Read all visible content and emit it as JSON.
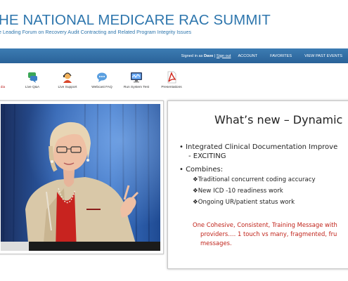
{
  "header": {
    "title": "HE NATIONAL MEDICARE RAC SUMMIT",
    "subtitle": "e Leading Forum on Recovery Audit Contracting and Related Program Integrity Issues"
  },
  "nav": {
    "signed_prefix": "Signed in as",
    "user": "Dave",
    "separator": "|",
    "signout": "Sign out",
    "links": [
      "ACCOUNT",
      "FAVORITES",
      "VIEW PAST EVENTS"
    ]
  },
  "toolbar": {
    "items": [
      {
        "label": "dia",
        "icon": "media-icon"
      },
      {
        "label": "Live Q&A",
        "icon": "chat-bubbles-icon"
      },
      {
        "label": "Live Support",
        "icon": "support-agent-icon"
      },
      {
        "label": "Webcast FAQ",
        "icon": "faq-bubble-icon"
      },
      {
        "label": "Run System Test",
        "icon": "system-test-monitor-icon"
      },
      {
        "label": "Presentations",
        "icon": "pdf-icon"
      }
    ]
  },
  "slide": {
    "title": "What’s new – Dynamic",
    "bullets": [
      {
        "line1": "• Integrated Clinical Documentation Improve",
        "line2": "- EXCITING"
      },
      {
        "line1": "• Combines:"
      }
    ],
    "subbullets": [
      "❖Traditional concurrent coding accuracy",
      "❖New ICD -10 readiness work",
      "❖Ongoing UR/patient status work"
    ],
    "highlight": [
      "One Cohesive, Consistent, Training Message with",
      "providers….  1 touch vs many, fragmented, fru",
      "messages."
    ]
  },
  "colors": {
    "brand_blue": "#2e76ad",
    "nav_bar": "#2f6ba3",
    "slide_red": "#c0241b"
  }
}
